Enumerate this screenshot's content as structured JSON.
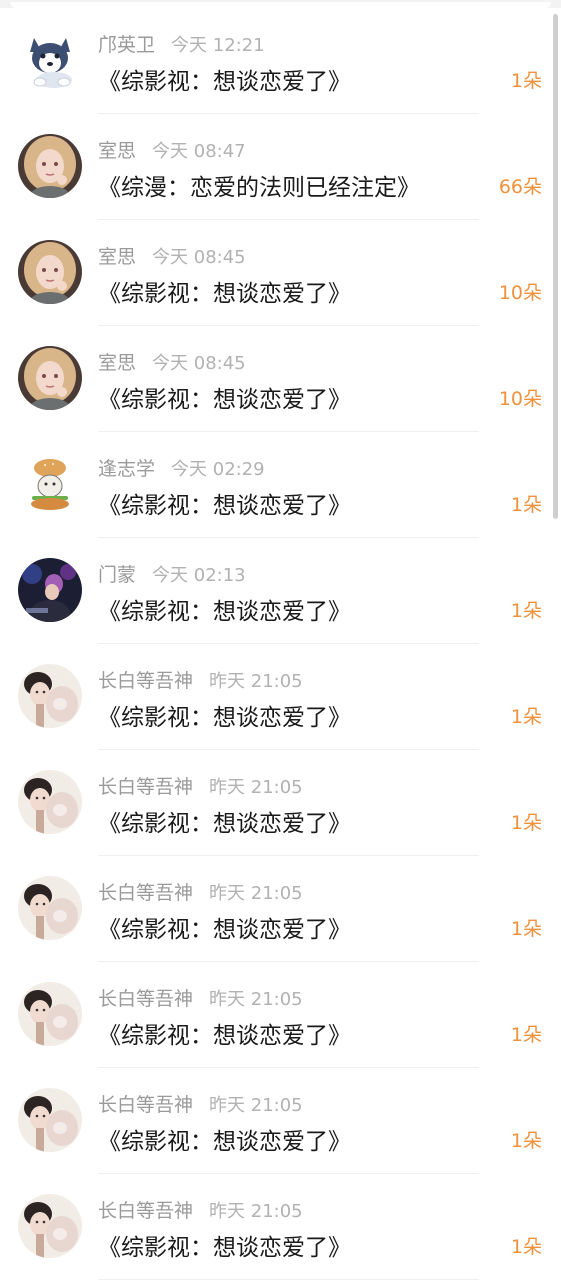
{
  "messages": [
    {
      "name": "邝英卫",
      "time": "今天 12:21",
      "title": "《综影视：想谈恋爱了》",
      "count": "1朵",
      "avatar": "husky-dog-avatar"
    },
    {
      "name": "室思",
      "time": "今天 08:47",
      "title": "《综漫：恋爱的法则已经注定》",
      "count": "66朵",
      "avatar": "anime-girl-avatar"
    },
    {
      "name": "室思",
      "time": "今天 08:45",
      "title": "《综影视：想谈恋爱了》",
      "count": "10朵",
      "avatar": "anime-girl-avatar"
    },
    {
      "name": "室思",
      "time": "今天 08:45",
      "title": "《综影视：想谈恋爱了》",
      "count": "10朵",
      "avatar": "anime-girl-avatar"
    },
    {
      "name": "逢志学",
      "time": "今天 02:29",
      "title": "《综影视：想谈恋爱了》",
      "count": "1朵",
      "avatar": "burger-cat-avatar"
    },
    {
      "name": "门蒙",
      "time": "今天 02:13",
      "title": "《综影视：想谈恋爱了》",
      "count": "1朵",
      "avatar": "performer-photo-avatar"
    },
    {
      "name": "长白等吾神",
      "time": "昨天 21:05",
      "title": "《综影视：想谈恋爱了》",
      "count": "1朵",
      "avatar": "girl-with-cat-avatar"
    },
    {
      "name": "长白等吾神",
      "time": "昨天 21:05",
      "title": "《综影视：想谈恋爱了》",
      "count": "1朵",
      "avatar": "girl-with-cat-avatar"
    },
    {
      "name": "长白等吾神",
      "time": "昨天 21:05",
      "title": "《综影视：想谈恋爱了》",
      "count": "1朵",
      "avatar": "girl-with-cat-avatar"
    },
    {
      "name": "长白等吾神",
      "time": "昨天 21:05",
      "title": "《综影视：想谈恋爱了》",
      "count": "1朵",
      "avatar": "girl-with-cat-avatar"
    },
    {
      "name": "长白等吾神",
      "time": "昨天 21:05",
      "title": "《综影视：想谈恋爱了》",
      "count": "1朵",
      "avatar": "girl-with-cat-avatar"
    },
    {
      "name": "长白等吾神",
      "time": "昨天 21:05",
      "title": "《综影视：想谈恋爱了》",
      "count": "1朵",
      "avatar": "girl-with-cat-avatar"
    }
  ],
  "colors": {
    "count_accent": "#f0913c",
    "name_text": "#9a9a9a",
    "time_text": "#b2b2b2",
    "title_text": "#1a1a1a"
  }
}
